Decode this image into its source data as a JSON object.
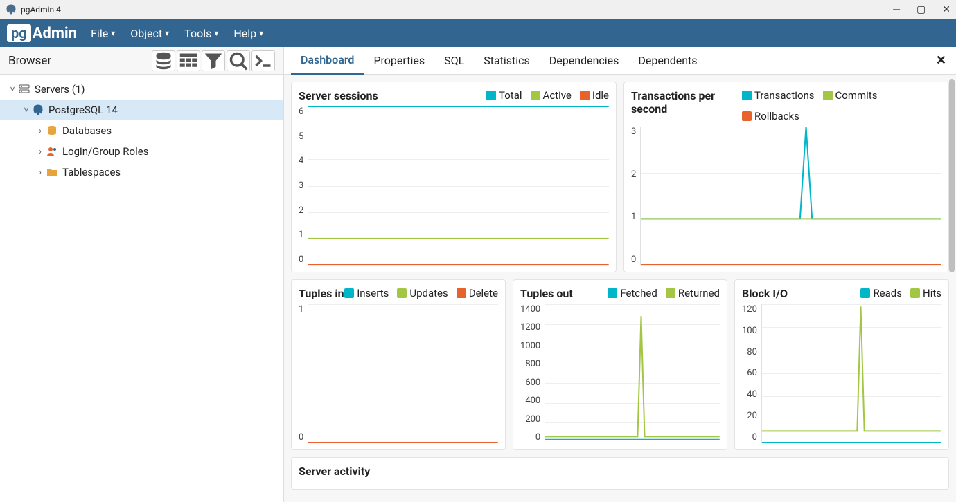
{
  "title": "pgAdmin 4",
  "logo": {
    "pg": "pg",
    "admin": "Admin"
  },
  "menubar": [
    {
      "label": "File"
    },
    {
      "label": "Object"
    },
    {
      "label": "Tools"
    },
    {
      "label": "Help"
    }
  ],
  "sidebar": {
    "title": "Browser",
    "tree": {
      "servers_label": "Servers (1)",
      "server_label": "PostgreSQL 14",
      "children": [
        {
          "label": "Databases"
        },
        {
          "label": "Login/Group Roles"
        },
        {
          "label": "Tablespaces"
        }
      ]
    }
  },
  "tabs": [
    {
      "label": "Dashboard",
      "active": true
    },
    {
      "label": "Properties"
    },
    {
      "label": "SQL"
    },
    {
      "label": "Statistics"
    },
    {
      "label": "Dependencies"
    },
    {
      "label": "Dependents"
    }
  ],
  "colors": {
    "cyan": "#00b6c9",
    "green": "#a3c644",
    "orange": "#e8622c"
  },
  "charts": {
    "sessions": {
      "title": "Server sessions",
      "legend": [
        {
          "name": "Total",
          "color": "cyan"
        },
        {
          "name": "Active",
          "color": "green"
        },
        {
          "name": "Idle",
          "color": "orange"
        }
      ],
      "yticks": [
        "6",
        "5",
        "4",
        "3",
        "2",
        "1",
        "0"
      ]
    },
    "tps": {
      "title": "Transactions per second",
      "legend": [
        {
          "name": "Transactions",
          "color": "cyan"
        },
        {
          "name": "Commits",
          "color": "green"
        },
        {
          "name": "Rollbacks",
          "color": "orange"
        }
      ],
      "yticks": [
        "3",
        "2",
        "1",
        "0"
      ]
    },
    "tuples_in": {
      "title": "Tuples in",
      "legend": [
        {
          "name": "Inserts",
          "color": "cyan"
        },
        {
          "name": "Updates",
          "color": "green"
        },
        {
          "name": "Delete",
          "color": "orange"
        }
      ],
      "yticks": [
        "1",
        "0"
      ]
    },
    "tuples_out": {
      "title": "Tuples out",
      "legend": [
        {
          "name": "Fetched",
          "color": "cyan"
        },
        {
          "name": "Returned",
          "color": "green"
        }
      ],
      "yticks": [
        "1400",
        "1200",
        "1000",
        "800",
        "600",
        "400",
        "200",
        "0"
      ]
    },
    "block_io": {
      "title": "Block I/O",
      "legend": [
        {
          "name": "Reads",
          "color": "cyan"
        },
        {
          "name": "Hits",
          "color": "green"
        }
      ],
      "yticks": [
        "120",
        "100",
        "80",
        "60",
        "40",
        "20",
        "0"
      ]
    }
  },
  "chart_data": [
    {
      "type": "line",
      "title": "Server sessions",
      "ylim": [
        0,
        6
      ],
      "series": [
        {
          "name": "Total",
          "color": "#00b6c9",
          "flat": 6
        },
        {
          "name": "Active",
          "color": "#a3c644",
          "flat": 1
        },
        {
          "name": "Idle",
          "color": "#e8622c",
          "flat": 0
        }
      ]
    },
    {
      "type": "line",
      "title": "Transactions per second",
      "ylim": [
        0,
        3
      ],
      "series": [
        {
          "name": "Transactions",
          "color": "#00b6c9",
          "base": 1,
          "spike": {
            "x": 0.55,
            "value": 3
          }
        },
        {
          "name": "Commits",
          "color": "#a3c644",
          "flat": 1
        },
        {
          "name": "Rollbacks",
          "color": "#e8622c",
          "flat": 0
        }
      ]
    },
    {
      "type": "line",
      "title": "Tuples in",
      "ylim": [
        0,
        1
      ],
      "series": [
        {
          "name": "Inserts",
          "color": "#00b6c9",
          "flat": 0
        },
        {
          "name": "Updates",
          "color": "#a3c644",
          "flat": 0
        },
        {
          "name": "Delete",
          "color": "#e8622c",
          "flat": 0
        }
      ]
    },
    {
      "type": "line",
      "title": "Tuples out",
      "ylim": [
        0,
        1400
      ],
      "series": [
        {
          "name": "Fetched",
          "color": "#00b6c9",
          "flat": 30
        },
        {
          "name": "Returned",
          "color": "#a3c644",
          "base": 60,
          "spike": {
            "x": 0.55,
            "value": 1280
          }
        }
      ]
    },
    {
      "type": "line",
      "title": "Block I/O",
      "ylim": [
        0,
        120
      ],
      "series": [
        {
          "name": "Reads",
          "color": "#00b6c9",
          "flat": 0
        },
        {
          "name": "Hits",
          "color": "#a3c644",
          "base": 10,
          "spike": {
            "x": 0.55,
            "value": 118
          }
        }
      ]
    }
  ],
  "activity": {
    "title": "Server activity"
  }
}
